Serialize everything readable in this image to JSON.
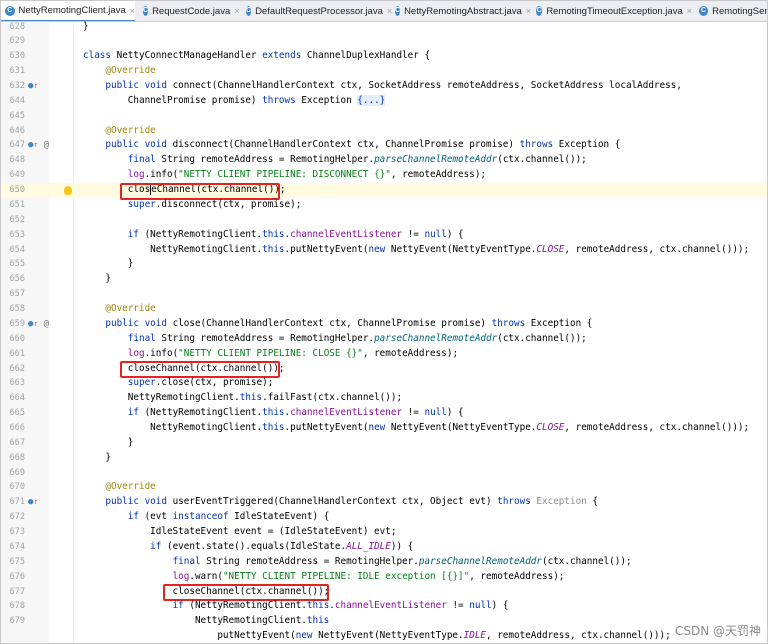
{
  "tabs": [
    {
      "label": "NettyRemotingClient.java",
      "active": true
    },
    {
      "label": "RequestCode.java",
      "active": false
    },
    {
      "label": "DefaultRequestProcessor.java",
      "active": false
    },
    {
      "label": "NettyRemotingAbstract.java",
      "active": false
    },
    {
      "label": "RemotingTimeoutException.java",
      "active": false
    },
    {
      "label": "RemotingSend",
      "active": false
    }
  ],
  "tab_close": "×",
  "class_icon": "C",
  "watermark": "CSDN @天罚神",
  "line_numbers": [
    "628",
    "629",
    "630",
    "631",
    "632",
    "644",
    "645",
    "646",
    "647",
    "648",
    "649",
    "650",
    "651",
    "652",
    "653",
    "654",
    "655",
    "656",
    "657",
    "658",
    "659",
    "660",
    "661",
    "662",
    "663",
    "664",
    "665",
    "666",
    "667",
    "668",
    "669",
    "670",
    "671",
    "672",
    "673",
    "674",
    "675",
    "676",
    "677",
    "678",
    "679"
  ],
  "colors": {
    "keyword": "#0033b3",
    "string": "#067d17",
    "annotation": "#9e880d",
    "field": "#871094",
    "highlight_box": "#e8231f",
    "tab_underline": "#4a88c7"
  }
}
